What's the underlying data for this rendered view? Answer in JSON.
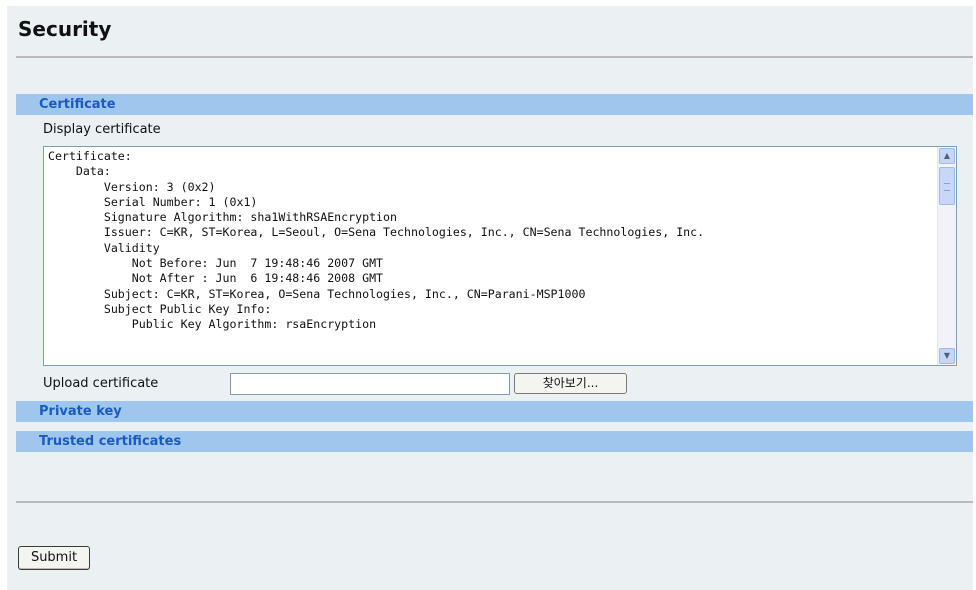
{
  "page": {
    "title": "Security"
  },
  "sections": {
    "certificate": {
      "header": "Certificate",
      "display_label": "Display certificate",
      "certificate_text": "Certificate:\n    Data:\n        Version: 3 (0x2)\n        Serial Number: 1 (0x1)\n        Signature Algorithm: sha1WithRSAEncryption\n        Issuer: C=KR, ST=Korea, L=Seoul, O=Sena Technologies, Inc., CN=Sena Technologies, Inc.\n        Validity\n            Not Before: Jun  7 19:48:46 2007 GMT\n            Not After : Jun  6 19:48:46 2008 GMT\n        Subject: C=KR, ST=Korea, O=Sena Technologies, Inc., CN=Parani-MSP1000\n        Subject Public Key Info:\n            Public Key Algorithm: rsaEncryption",
      "upload_label": "Upload certificate",
      "upload_value": "",
      "browse_label": "찾아보기..."
    },
    "private_key": {
      "header": "Private key"
    },
    "trusted_certificates": {
      "header": "Trusted certificates"
    }
  },
  "form": {
    "submit_label": "Submit"
  },
  "colors": {
    "page_background": "#ebf0f2",
    "section_bar": "#9fc6ec",
    "section_text": "#1a5bbf",
    "rule": "#b9b9b9"
  },
  "icons": {
    "scroll_up": "chevron-up-icon",
    "scroll_down": "chevron-down-icon"
  }
}
